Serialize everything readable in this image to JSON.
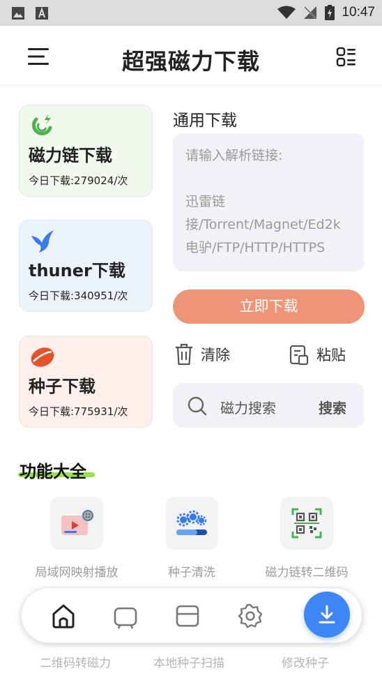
{
  "status": {
    "time": "10:47"
  },
  "header": {
    "title": "超强磁力下载"
  },
  "cards": [
    {
      "title": "磁力链下载",
      "sub": "今日下载:279024/次"
    },
    {
      "title": "thuner下载",
      "sub": "今日下载:340951/次"
    },
    {
      "title": "种子下载",
      "sub": "今日下载:775931/次"
    }
  ],
  "general": {
    "label": "通用下载",
    "placeholder_line1": "请输入解析链接:",
    "placeholder_line2": "迅雷链接/Torrent/Magnet/Ed2k电驴/FTP/HTTP/HTTPS",
    "download_button": "立即下载",
    "clear": "清除",
    "paste": "粘贴"
  },
  "search": {
    "placeholder": "磁力搜索",
    "button": "搜索"
  },
  "features": {
    "title": "功能大全",
    "items": [
      {
        "label": "局域网映射播放"
      },
      {
        "label": "种子清洗"
      },
      {
        "label": "磁力链转二维码"
      }
    ],
    "next_row": [
      {
        "label": "二维码转磁力"
      },
      {
        "label": "本地种子扫描"
      },
      {
        "label": "修改种子"
      }
    ]
  },
  "colors": {
    "accent_button": "#ee9578",
    "fab": "#3f85f6",
    "underline": "#9be04d"
  }
}
